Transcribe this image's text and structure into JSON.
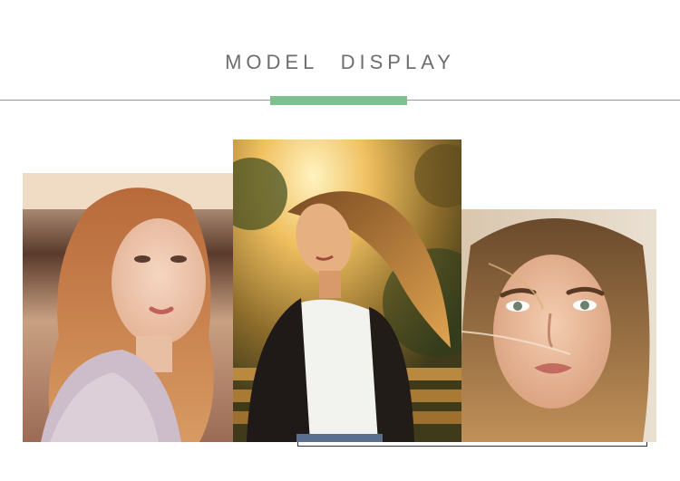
{
  "header": {
    "title": "MODEL  DISPLAY"
  },
  "colors": {
    "accent": "#7ec08f",
    "title_text": "#6e6e6e",
    "rule": "#9a9a9a"
  },
  "photos": [
    {
      "subject": "model-portrait-blonde-wavy-hair"
    },
    {
      "subject": "model-leather-jacket-sunset-bench"
    },
    {
      "subject": "model-closeup-tousled-hair"
    }
  ]
}
